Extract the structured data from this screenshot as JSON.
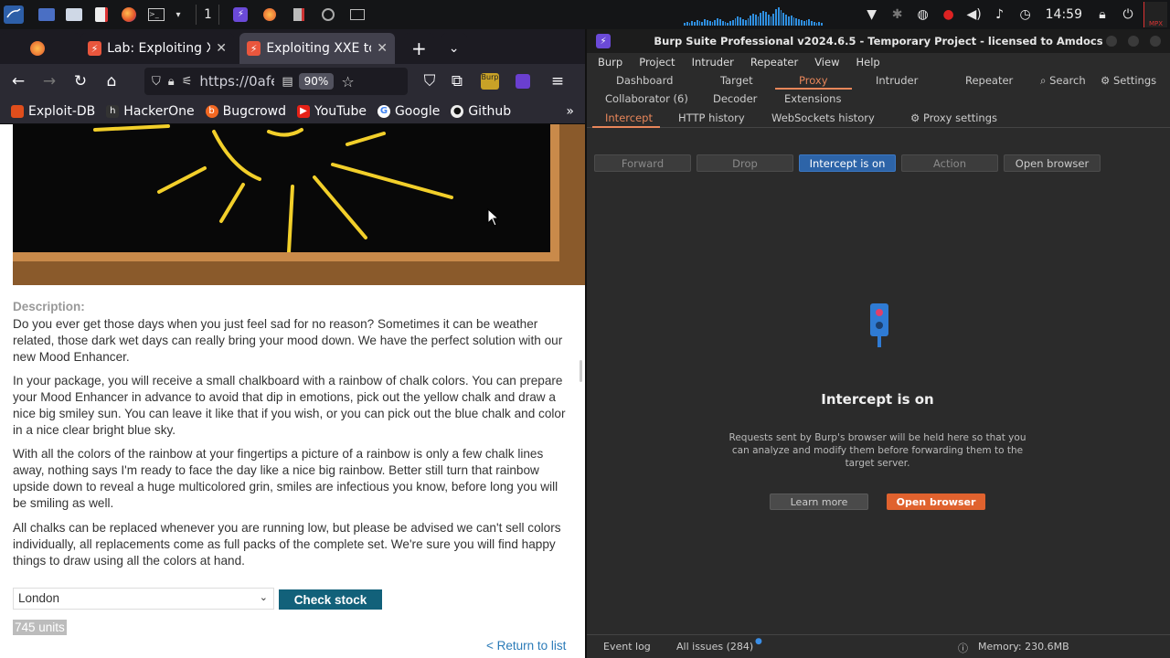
{
  "taskbar": {
    "workspace": "1",
    "clock": "14:59"
  },
  "firefox": {
    "tabs": [
      {
        "title": "Lab: Exploiting XX"
      },
      {
        "title": "Exploiting XXE to"
      }
    ],
    "url": "https://0afe",
    "zoom": "90%",
    "bookmarks": [
      "Exploit-DB",
      "HackerOne",
      "Bugcrowd",
      "YouTube",
      "Google",
      "Github"
    ]
  },
  "page": {
    "description_label": "Description:",
    "paragraphs": [
      "Do you ever get those days when you just feel sad for no reason? Sometimes it can be weather related, those dark wet days can really bring your mood down. We have the perfect solution with our new Mood Enhancer.",
      "In your package, you will receive a small chalkboard with a rainbow of chalk colors. You can prepare your Mood Enhancer in advance to avoid that dip in emotions, pick out the yellow chalk and draw a nice big smiley sun. You can leave it like that if you wish, or you can pick out the blue chalk and color in a nice clear bright blue sky.",
      "With all the colors of the rainbow at your fingertips a picture of a rainbow is only a few chalk lines away, nothing says I'm ready to face the day like a nice big rainbow. Better still turn that rainbow upside down to reveal a huge multicolored grin, smiles are infectious you know, before long you will be smiling as well.",
      "All chalks can be replaced whenever you are running low, but please be advised we can't sell colors individually, all replacements come as full packs of the complete set. We're sure you will find happy things to draw using all the colors at hand."
    ],
    "store_selected": "London",
    "check_stock_label": "Check stock",
    "stock_result": "745 units",
    "return_link": "< Return to list"
  },
  "burp": {
    "title": "Burp Suite Professional v2024.6.5 - Temporary Project - licensed to Amdocs",
    "menu": [
      "Burp",
      "Project",
      "Intruder",
      "Repeater",
      "View",
      "Help"
    ],
    "nav_row1": [
      "Dashboard",
      "Target",
      "Proxy",
      "Intruder",
      "Repeater"
    ],
    "search": "Search",
    "settings": "Settings",
    "nav_row2": [
      "Collaborator (6)",
      "Decoder",
      "Extensions"
    ],
    "subtabs": [
      "Intercept",
      "HTTP history",
      "WebSockets history"
    ],
    "proxy_settings": "Proxy settings",
    "toolbar": [
      "Forward",
      "Drop",
      "Intercept is on",
      "Action",
      "Open browser"
    ],
    "empty_heading": "Intercept is on",
    "empty_text": "Requests sent by Burp's browser will be held here so that you can analyze and modify them before forwarding them to the target server.",
    "learn_more": "Learn more",
    "open_browser": "Open browser",
    "status": {
      "event_log": "Event log",
      "all_issues": "All issues (284)",
      "memory": "Memory: 230.6MB"
    },
    "colors": {
      "accent": "#e8865a",
      "intercept_on": "#2d64a8",
      "open_browser": "#e0622e"
    }
  }
}
